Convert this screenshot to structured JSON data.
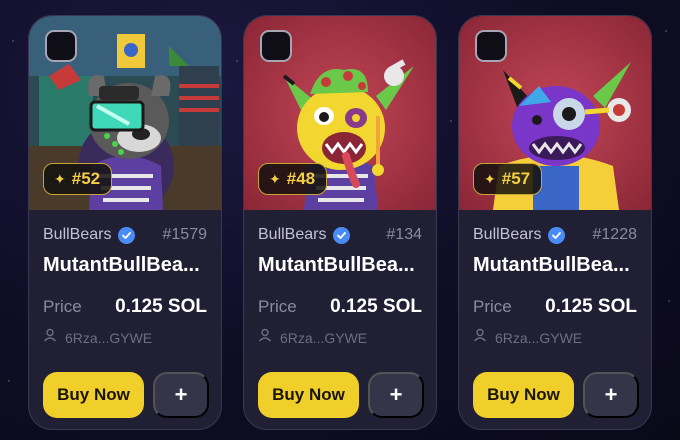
{
  "cards": [
    {
      "rank": "#52",
      "collection": "BullBears",
      "token_id": "#1579",
      "name": "MutantBullBea...",
      "price_label": "Price",
      "price": "0.125 SOL",
      "owner": "6Rza...GYWE",
      "buy_label": "Buy Now",
      "add_label": "+",
      "art": {
        "background": "#2c4a52",
        "character_color": "#5a5a5a",
        "accent": "#3fd8b8"
      }
    },
    {
      "rank": "#48",
      "collection": "BullBears",
      "token_id": "#134",
      "name": "MutantBullBea...",
      "price_label": "Price",
      "price": "0.125 SOL",
      "owner": "6Rza...GYWE",
      "buy_label": "Buy Now",
      "add_label": "+",
      "art": {
        "background": "#b03a4a",
        "character_color": "#f2d730",
        "accent": "#6bc94a"
      }
    },
    {
      "rank": "#57",
      "collection": "BullBears",
      "token_id": "#1228",
      "name": "MutantBullBea...",
      "price_label": "Price",
      "price": "0.125 SOL",
      "owner": "6Rza...GYWE",
      "buy_label": "Buy Now",
      "add_label": "+",
      "art": {
        "background": "#b03a4a",
        "character_color": "#7a35c9",
        "accent": "#f4cf3a"
      }
    }
  ],
  "theme": {
    "accent": "#f0cf2b",
    "card_bg": "#211f33",
    "verified": "#4a8cf5"
  }
}
